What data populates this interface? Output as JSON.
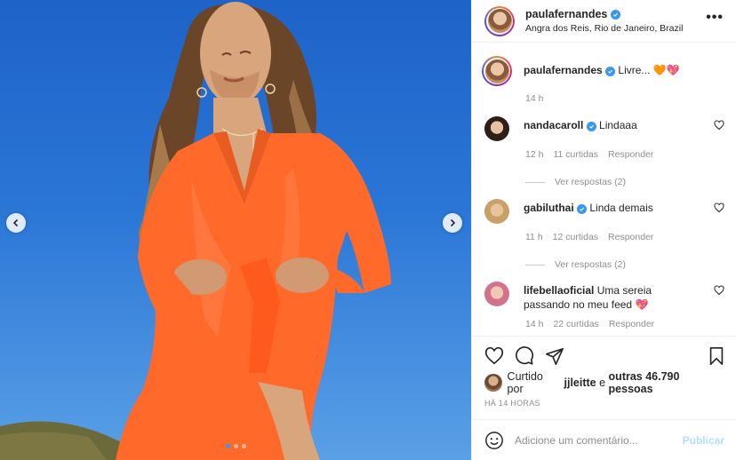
{
  "post": {
    "photo_alt": "",
    "carousel": {
      "count": 3,
      "active": 1
    }
  },
  "header": {
    "username": "paulafernandes",
    "location": "Angra dos Reis, Rio de Janeiro, Brazil",
    "more_label": "•••"
  },
  "caption": {
    "username": "paulafernandes",
    "text": "Livre...",
    "emoji": "🧡💖",
    "time": "14 h"
  },
  "comments": [
    {
      "username": "nandacaroll",
      "verified": true,
      "text": "Lindaaa",
      "time": "12 h",
      "likes": "11 curtidas",
      "reply": "Responder",
      "view_replies": "Ver respostas (2)",
      "avatar_color": "#3b2a22"
    },
    {
      "username": "gabiluthai",
      "verified": true,
      "text": "Linda demais",
      "time": "11 h",
      "likes": "12 curtidas",
      "reply": "Responder",
      "view_replies": "Ver respostas (2)",
      "avatar_color": "#c9a067"
    },
    {
      "username": "lifebellaoficial",
      "verified": false,
      "text": "Uma sereia passando no meu feed",
      "emoji": "💖",
      "time": "14 h",
      "likes": "22 curtidas",
      "reply": "Responder",
      "avatar_color": "#d4728e"
    }
  ],
  "likes": {
    "prefix": "Curtido por",
    "user": "jjleitte",
    "middle": "e",
    "others": "outras 46.790 pessoas"
  },
  "timestamp": "HÁ 14 HORAS",
  "add_comment": {
    "placeholder": "Adicione um comentário...",
    "publish_label": "Publicar"
  },
  "colors": {
    "accent": "#3897f0",
    "publish_disabled": "#b2dffc",
    "dress": "#ff6a2b"
  }
}
